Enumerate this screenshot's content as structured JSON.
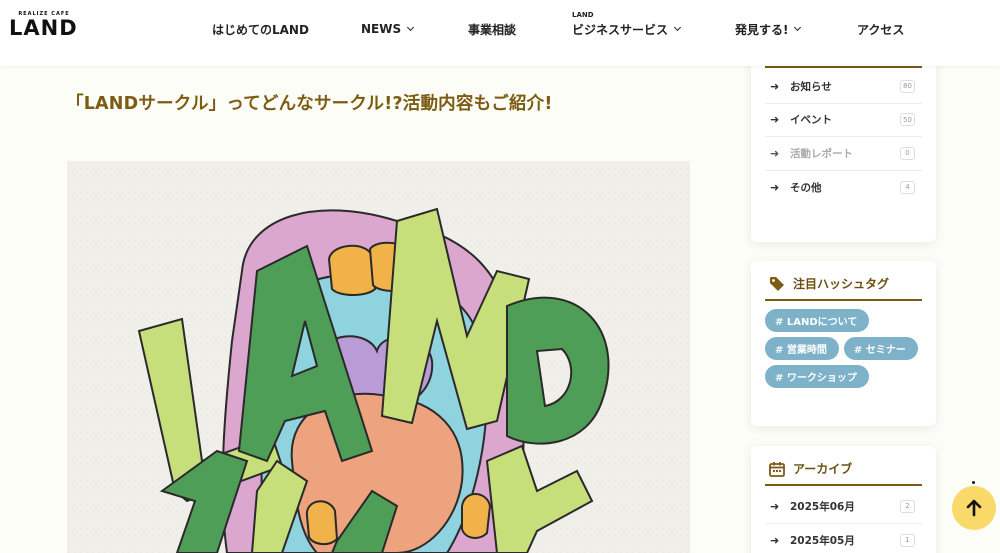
{
  "logo": {
    "sub": "REALIZE CAFE",
    "main": "LAND"
  },
  "nav": {
    "items": [
      {
        "label": "はじめてのLAND",
        "has_dropdown": false
      },
      {
        "label": "NEWS",
        "has_dropdown": true
      },
      {
        "label": "事業相談",
        "has_dropdown": false
      },
      {
        "label": "ビジネスサービス",
        "overline": "LAND",
        "has_dropdown": true
      },
      {
        "label": "発見する!",
        "has_dropdown": true
      },
      {
        "label": "アクセス",
        "has_dropdown": false
      }
    ]
  },
  "article": {
    "title": "「LANDサークル」ってどんなサークル!?活動内容もご紹介!",
    "hero_lettering": "LAND"
  },
  "sidebar": {
    "categories": {
      "items": [
        {
          "label": "お知らせ",
          "count": "80",
          "muted": false
        },
        {
          "label": "イベント",
          "count": "50",
          "muted": false
        },
        {
          "label": "活動レポート",
          "count": "0",
          "muted": true
        },
        {
          "label": "その他",
          "count": "4",
          "muted": false
        }
      ]
    },
    "hashtags": {
      "title": "注目ハッシュタグ",
      "items": [
        {
          "label": "# LANDについて"
        },
        {
          "label": "# 営業時間"
        },
        {
          "label": "# セミナー"
        },
        {
          "label": "# ワークショップ"
        }
      ]
    },
    "archive": {
      "title": "アーカイブ",
      "items": [
        {
          "label": "2025年06月",
          "count": "2"
        },
        {
          "label": "2025年05月",
          "count": "1"
        }
      ]
    }
  },
  "colors": {
    "accent": "#7c5b12",
    "tag_bg": "#7eb2c9",
    "to_top_bg": "#f8d96a",
    "page_bg": "#fdfdf7"
  },
  "icons": {
    "tag": "tag-icon",
    "calendar": "calendar-icon",
    "arrow": "arrow-right-icon",
    "to_top": "arrow-up-icon"
  }
}
